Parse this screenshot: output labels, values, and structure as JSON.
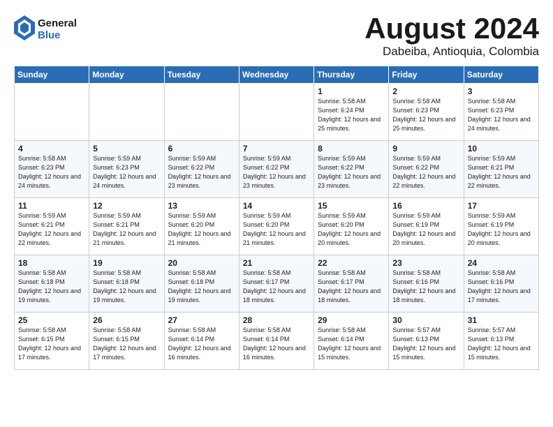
{
  "logo": {
    "general": "General",
    "blue": "Blue"
  },
  "title": "August 2024",
  "location": "Dabeiba, Antioquia, Colombia",
  "days_of_week": [
    "Sunday",
    "Monday",
    "Tuesday",
    "Wednesday",
    "Thursday",
    "Friday",
    "Saturday"
  ],
  "weeks": [
    [
      {
        "day": "",
        "sunrise": "",
        "sunset": "",
        "daylight": ""
      },
      {
        "day": "",
        "sunrise": "",
        "sunset": "",
        "daylight": ""
      },
      {
        "day": "",
        "sunrise": "",
        "sunset": "",
        "daylight": ""
      },
      {
        "day": "",
        "sunrise": "",
        "sunset": "",
        "daylight": ""
      },
      {
        "day": "1",
        "sunrise": "Sunrise: 5:58 AM",
        "sunset": "Sunset: 6:24 PM",
        "daylight": "Daylight: 12 hours and 25 minutes."
      },
      {
        "day": "2",
        "sunrise": "Sunrise: 5:58 AM",
        "sunset": "Sunset: 6:23 PM",
        "daylight": "Daylight: 12 hours and 25 minutes."
      },
      {
        "day": "3",
        "sunrise": "Sunrise: 5:58 AM",
        "sunset": "Sunset: 6:23 PM",
        "daylight": "Daylight: 12 hours and 24 minutes."
      }
    ],
    [
      {
        "day": "4",
        "sunrise": "Sunrise: 5:58 AM",
        "sunset": "Sunset: 6:23 PM",
        "daylight": "Daylight: 12 hours and 24 minutes."
      },
      {
        "day": "5",
        "sunrise": "Sunrise: 5:59 AM",
        "sunset": "Sunset: 6:23 PM",
        "daylight": "Daylight: 12 hours and 24 minutes."
      },
      {
        "day": "6",
        "sunrise": "Sunrise: 5:59 AM",
        "sunset": "Sunset: 6:22 PM",
        "daylight": "Daylight: 12 hours and 23 minutes."
      },
      {
        "day": "7",
        "sunrise": "Sunrise: 5:59 AM",
        "sunset": "Sunset: 6:22 PM",
        "daylight": "Daylight: 12 hours and 23 minutes."
      },
      {
        "day": "8",
        "sunrise": "Sunrise: 5:59 AM",
        "sunset": "Sunset: 6:22 PM",
        "daylight": "Daylight: 12 hours and 23 minutes."
      },
      {
        "day": "9",
        "sunrise": "Sunrise: 5:59 AM",
        "sunset": "Sunset: 6:22 PM",
        "daylight": "Daylight: 12 hours and 22 minutes."
      },
      {
        "day": "10",
        "sunrise": "Sunrise: 5:59 AM",
        "sunset": "Sunset: 6:21 PM",
        "daylight": "Daylight: 12 hours and 22 minutes."
      }
    ],
    [
      {
        "day": "11",
        "sunrise": "Sunrise: 5:59 AM",
        "sunset": "Sunset: 6:21 PM",
        "daylight": "Daylight: 12 hours and 22 minutes."
      },
      {
        "day": "12",
        "sunrise": "Sunrise: 5:59 AM",
        "sunset": "Sunset: 6:21 PM",
        "daylight": "Daylight: 12 hours and 21 minutes."
      },
      {
        "day": "13",
        "sunrise": "Sunrise: 5:59 AM",
        "sunset": "Sunset: 6:20 PM",
        "daylight": "Daylight: 12 hours and 21 minutes."
      },
      {
        "day": "14",
        "sunrise": "Sunrise: 5:59 AM",
        "sunset": "Sunset: 6:20 PM",
        "daylight": "Daylight: 12 hours and 21 minutes."
      },
      {
        "day": "15",
        "sunrise": "Sunrise: 5:59 AM",
        "sunset": "Sunset: 6:20 PM",
        "daylight": "Daylight: 12 hours and 20 minutes."
      },
      {
        "day": "16",
        "sunrise": "Sunrise: 5:59 AM",
        "sunset": "Sunset: 6:19 PM",
        "daylight": "Daylight: 12 hours and 20 minutes."
      },
      {
        "day": "17",
        "sunrise": "Sunrise: 5:59 AM",
        "sunset": "Sunset: 6:19 PM",
        "daylight": "Daylight: 12 hours and 20 minutes."
      }
    ],
    [
      {
        "day": "18",
        "sunrise": "Sunrise: 5:58 AM",
        "sunset": "Sunset: 6:18 PM",
        "daylight": "Daylight: 12 hours and 19 minutes."
      },
      {
        "day": "19",
        "sunrise": "Sunrise: 5:58 AM",
        "sunset": "Sunset: 6:18 PM",
        "daylight": "Daylight: 12 hours and 19 minutes."
      },
      {
        "day": "20",
        "sunrise": "Sunrise: 5:58 AM",
        "sunset": "Sunset: 6:18 PM",
        "daylight": "Daylight: 12 hours and 19 minutes."
      },
      {
        "day": "21",
        "sunrise": "Sunrise: 5:58 AM",
        "sunset": "Sunset: 6:17 PM",
        "daylight": "Daylight: 12 hours and 18 minutes."
      },
      {
        "day": "22",
        "sunrise": "Sunrise: 5:58 AM",
        "sunset": "Sunset: 6:17 PM",
        "daylight": "Daylight: 12 hours and 18 minutes."
      },
      {
        "day": "23",
        "sunrise": "Sunrise: 5:58 AM",
        "sunset": "Sunset: 6:16 PM",
        "daylight": "Daylight: 12 hours and 18 minutes."
      },
      {
        "day": "24",
        "sunrise": "Sunrise: 5:58 AM",
        "sunset": "Sunset: 6:16 PM",
        "daylight": "Daylight: 12 hours and 17 minutes."
      }
    ],
    [
      {
        "day": "25",
        "sunrise": "Sunrise: 5:58 AM",
        "sunset": "Sunset: 6:15 PM",
        "daylight": "Daylight: 12 hours and 17 minutes."
      },
      {
        "day": "26",
        "sunrise": "Sunrise: 5:58 AM",
        "sunset": "Sunset: 6:15 PM",
        "daylight": "Daylight: 12 hours and 17 minutes."
      },
      {
        "day": "27",
        "sunrise": "Sunrise: 5:58 AM",
        "sunset": "Sunset: 6:14 PM",
        "daylight": "Daylight: 12 hours and 16 minutes."
      },
      {
        "day": "28",
        "sunrise": "Sunrise: 5:58 AM",
        "sunset": "Sunset: 6:14 PM",
        "daylight": "Daylight: 12 hours and 16 minutes."
      },
      {
        "day": "29",
        "sunrise": "Sunrise: 5:58 AM",
        "sunset": "Sunset: 6:14 PM",
        "daylight": "Daylight: 12 hours and 15 minutes."
      },
      {
        "day": "30",
        "sunrise": "Sunrise: 5:57 AM",
        "sunset": "Sunset: 6:13 PM",
        "daylight": "Daylight: 12 hours and 15 minutes."
      },
      {
        "day": "31",
        "sunrise": "Sunrise: 5:57 AM",
        "sunset": "Sunset: 6:13 PM",
        "daylight": "Daylight: 12 hours and 15 minutes."
      }
    ]
  ]
}
